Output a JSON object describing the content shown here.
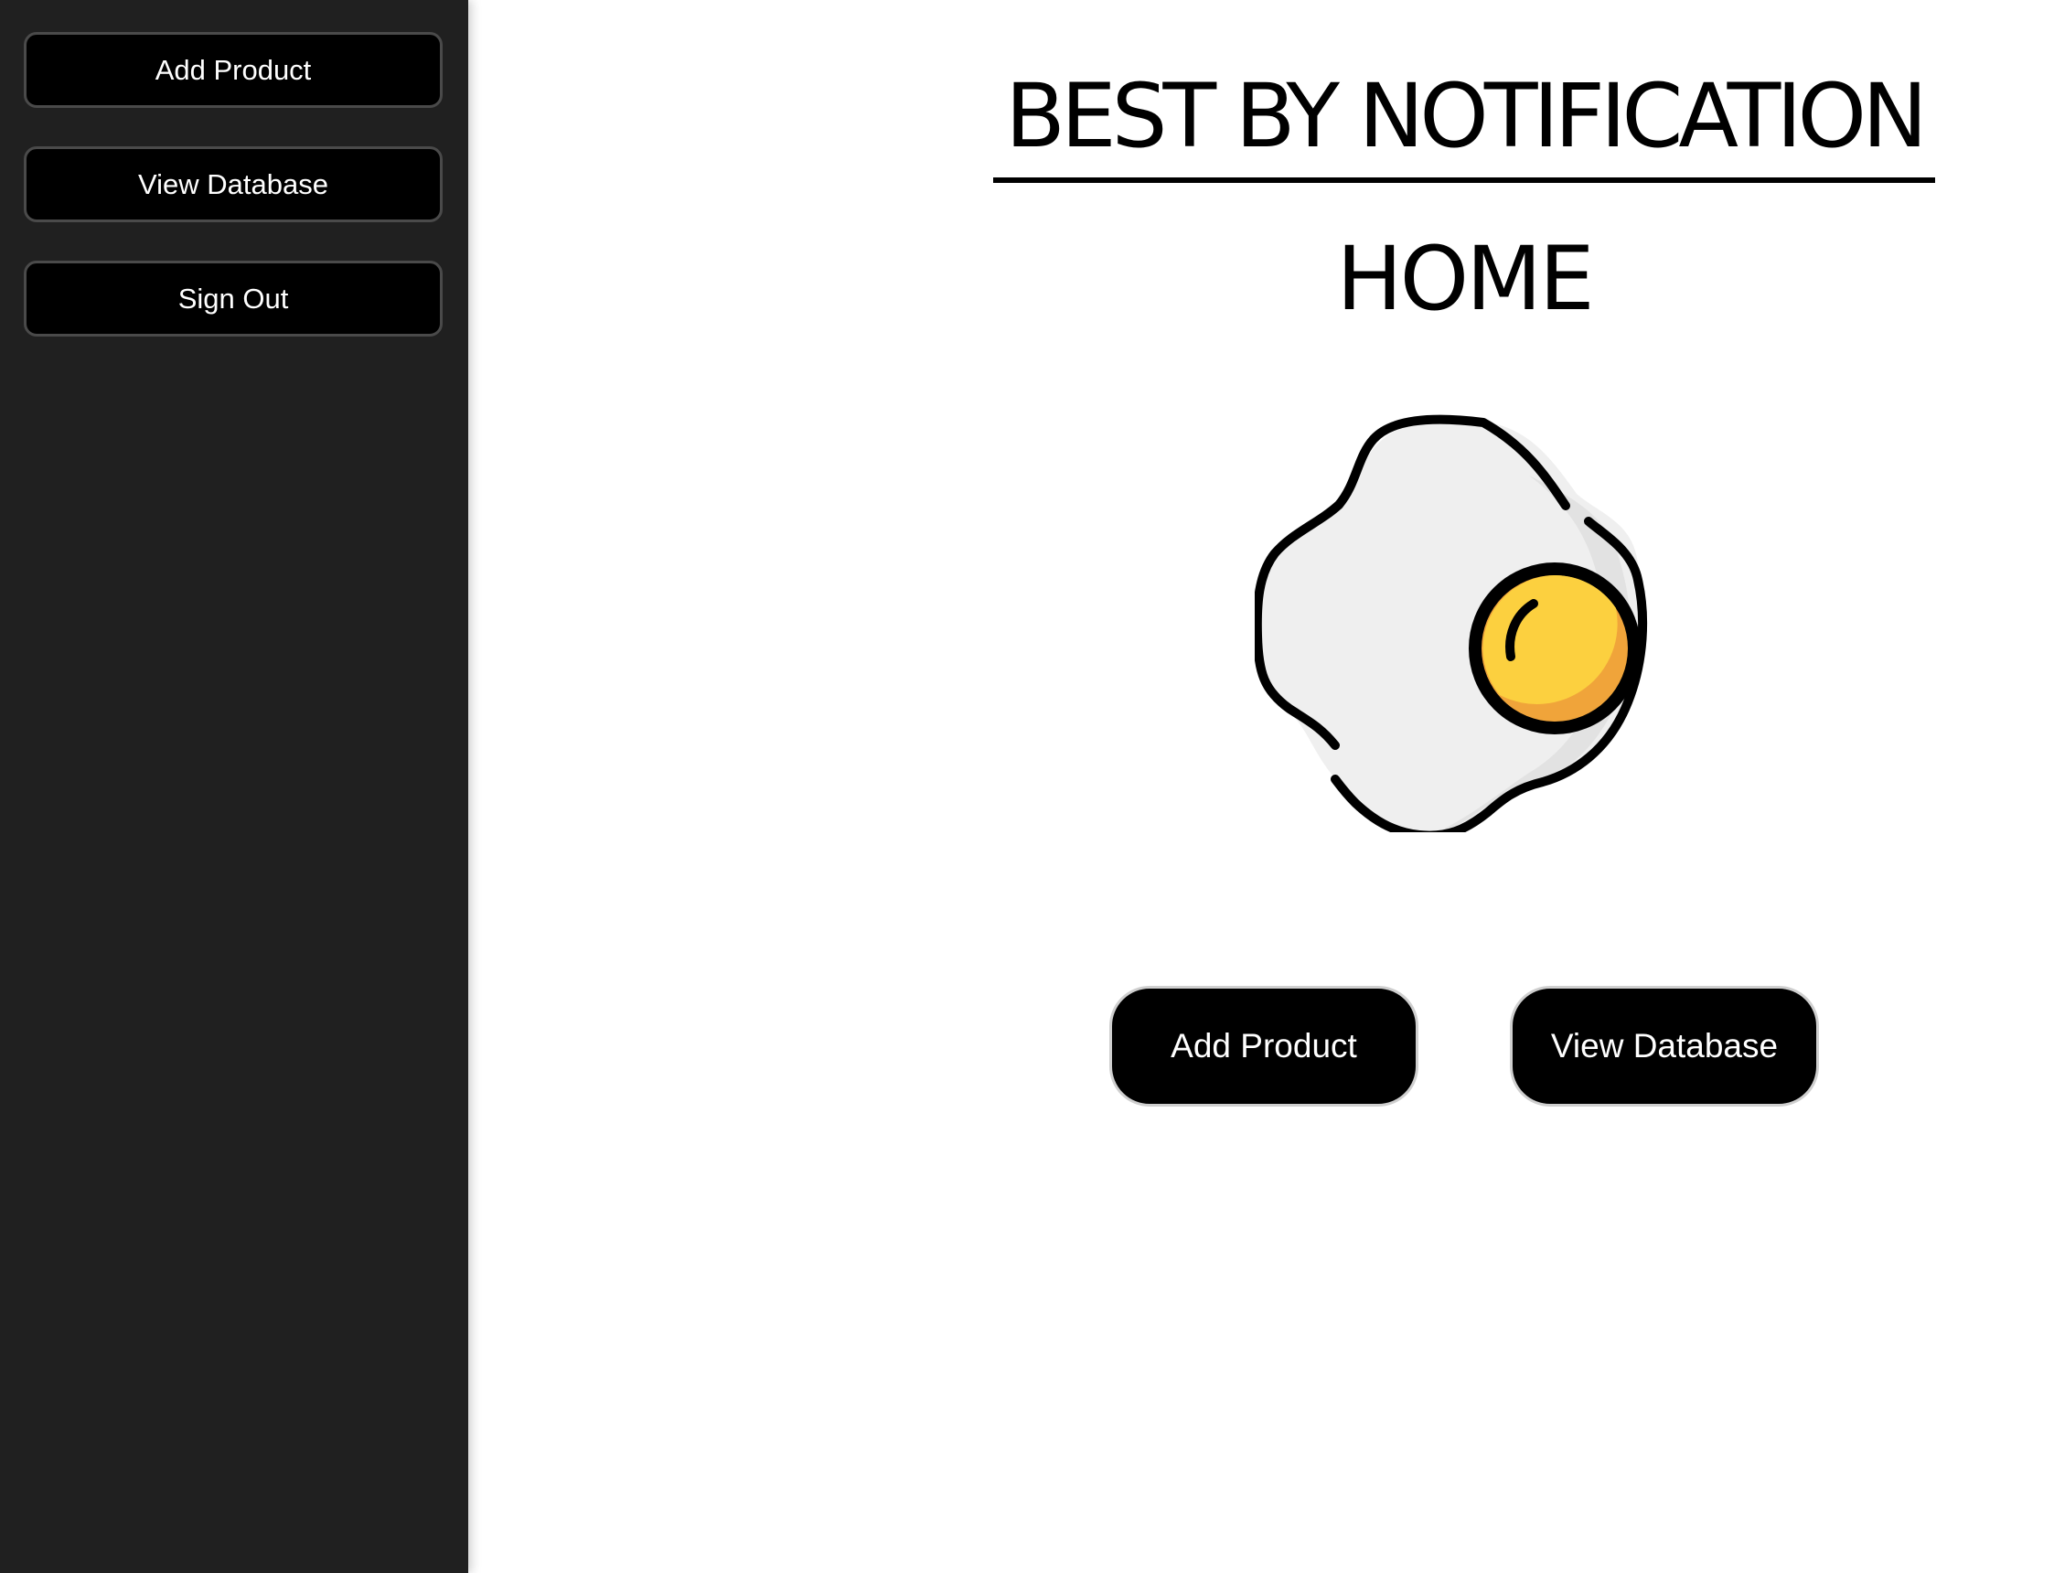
{
  "sidebar": {
    "items": [
      {
        "label": "Add Product"
      },
      {
        "label": "View Database"
      },
      {
        "label": "Sign Out"
      }
    ]
  },
  "main": {
    "title": "BEST BY NOTIFICATION",
    "subtitle": "HOME",
    "illustration": "fried-egg-icon",
    "buttons": [
      {
        "label": "Add Product"
      },
      {
        "label": "View Database"
      }
    ]
  },
  "colors": {
    "sidebar_bg": "#202020",
    "button_bg": "#000000",
    "egg_white": "#efefef",
    "egg_yolk": "#fcd03f",
    "egg_yolk_shade": "#f0a43a"
  }
}
